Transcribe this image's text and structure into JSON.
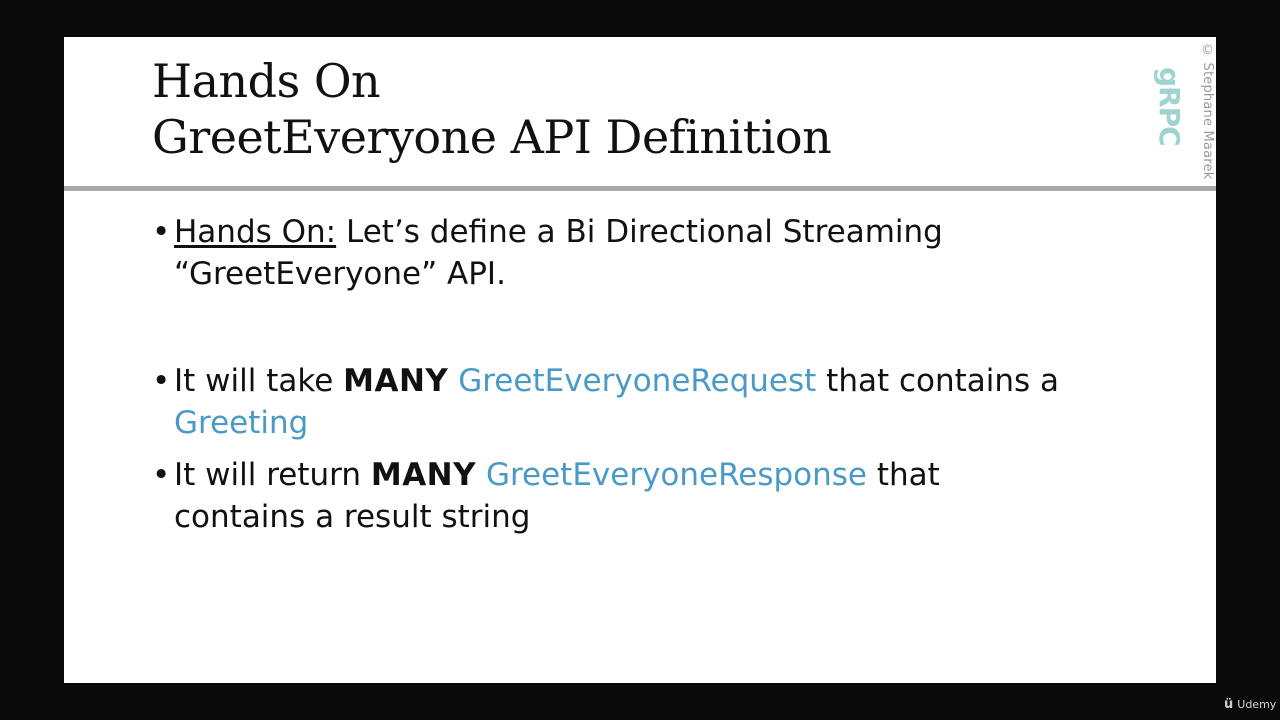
{
  "slide": {
    "title_line1": "Hands On",
    "title_line2": "GreetEveryone API Definition",
    "copyright": "© Stephane Maarek",
    "logo_text": "gRPC",
    "bullet_symbol": "•",
    "bullets": [
      {
        "label": "Hands On:",
        "line1": " Let’s define a Bi Directional Streaming",
        "line2": "“GreetEveryone” API."
      },
      {
        "prefix": "It will take ",
        "emphasis": "MANY",
        "type_name": "GreetEveryoneRequest",
        "suffix": " that contains a",
        "field": "Greeting"
      },
      {
        "prefix": "It will return ",
        "emphasis": "MANY",
        "type_name": "GreetEveryoneResponse",
        "suffix": " that",
        "line2": "contains a result string"
      }
    ]
  },
  "watermark": {
    "brand": "Udemy",
    "icon": "udemy-logo-icon"
  },
  "colors": {
    "accent_blue": "#4a9ac7",
    "logo_teal": "#9fd3cf",
    "rule_gray": "#a8a8a8"
  }
}
